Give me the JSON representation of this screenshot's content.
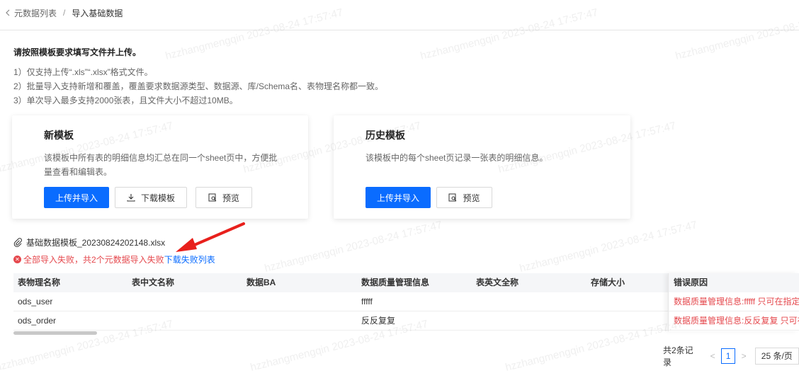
{
  "breadcrumb": {
    "back_label": "元数据列表",
    "separator": "/",
    "current": "导入基础数据"
  },
  "instructions": {
    "title": "请按照模板要求填写文件并上传。",
    "items": [
      "1）仅支持上传“.xls”“.xlsx”格式文件。",
      "2）批量导入支持新增和覆盖，覆盖要求数据源类型、数据源、库/Schema名、表物理名称都一致。",
      "3）单次导入最多支持2000张表，且文件大小不超过10MB。"
    ]
  },
  "cards": [
    {
      "title": "新模板",
      "desc": "该模板中所有表的明细信息均汇总在同一个sheet页中，方便批量查看和编辑表。",
      "upload_label": "上传并导入",
      "download_label": "下载模板",
      "preview_label": "预览"
    },
    {
      "title": "历史模板",
      "desc": "该模板中的每个sheet页记录一张表的明细信息。",
      "upload_label": "上传并导入",
      "preview_label": "预览"
    }
  ],
  "file": {
    "name": "基础数据模板_20230824202148.xlsx"
  },
  "result": {
    "error_text": "全部导入失败，共2个元数据导入失败",
    "download_link": "下载失败列表"
  },
  "table": {
    "columns": [
      "表物理名称",
      "表中文名称",
      "数据BA",
      "数据质量管理信息",
      "表英文全称",
      "存储大小",
      "错误原因"
    ],
    "rows": [
      [
        "ods_user",
        "",
        "",
        "fffff",
        "",
        "",
        "数据质量管理信息:fffff 只可在指定"
      ],
      [
        "ods_order",
        "",
        "",
        "反反复复",
        "",
        "",
        "数据质量管理信息:反反复复 只可在"
      ]
    ]
  },
  "pagination": {
    "total": "共2条记录",
    "current_page": "1",
    "page_size": "25 条/页"
  },
  "watermark": "hzzhangmengqin 2023-08-24 17:57:47",
  "colors": {
    "primary": "#0a6cff",
    "error": "#e5484d"
  }
}
